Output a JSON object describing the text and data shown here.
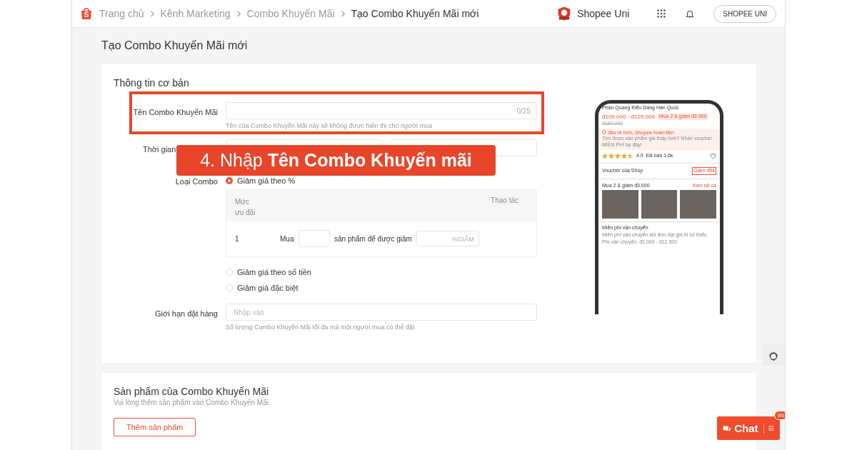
{
  "logo_letter": "S",
  "breadcrumb": [
    {
      "label": "Trang chủ",
      "current": false
    },
    {
      "label": "Kênh Marketing",
      "current": false
    },
    {
      "label": "Combo Khuyến Mãi",
      "current": false
    },
    {
      "label": "Tạo Combo Khuyến Mãi mới",
      "current": true
    }
  ],
  "header": {
    "brand": "Shopee Uni",
    "account_button": "SHOPEE UNI"
  },
  "page_title": "Tạo Combo Khuyến Mãi mới",
  "basic_info": {
    "title": "Thông tin cơ bản",
    "name_field": {
      "label": "Tên Combo Khuyến Mãi",
      "counter": "0/25",
      "hint": "Tên của Combo Khuyến Mãi này sẽ không được hiển thị cho người mua"
    },
    "time_field": {
      "label": "Thời gian"
    },
    "combo_type": {
      "label": "Loại Combo",
      "options": [
        {
          "label": "Giảm giá theo %",
          "selected": true
        },
        {
          "label": "Giảm giá theo số tiền",
          "selected": false
        },
        {
          "label": "Giảm giá đặc biệt",
          "selected": false
        }
      ]
    },
    "tier_table": {
      "columns": [
        "Mức ưu đãi",
        "Thao tác"
      ],
      "rows": [
        {
          "index": "1",
          "buy_label": "Mua",
          "middle_text": "sản phẩm để được giảm",
          "unit": "%GIẢM"
        }
      ]
    },
    "limit_field": {
      "label": "Giới hạn đặt hàng",
      "placeholder": "Nhập vào",
      "hint": "Số lượng Combo Khuyến Mãi tối đa mà một người mua có thể đặt"
    }
  },
  "callout": "4. Nhập **Tên Combo Khuyến mãi**",
  "phone_preview": {
    "title": "Phản Quang Kiểu Dáng Hàn Quốc",
    "price": "đ109.000 - đ129.000",
    "deal_tag": "Mua 2 & giảm đ3.000",
    "old_price": "đ180.000",
    "refund_title": "Ở đâu rẻ hơn, Shopee hoàn tiền",
    "refund_text": "Tìm được sản phẩm giá thấp hơn? Nhấn voucher MIỄN PHÍ tại đây!",
    "stars": 4.5,
    "rating": "4.9",
    "sold": "Đã bán 1,6k",
    "voucher_label": "Voucher của Shop",
    "voucher_tag": "Giảm đ5k",
    "combo_label": "Mua 2 & giảm đ3.000",
    "see_all": "Xem tất cả",
    "shipping_title": "Miễn phí vận chuyển",
    "shipping_text": "Miễn phí vận chuyển khi đơn đạt giá trị tối thiểu",
    "shipping_fee": "Phí vận chuyển: đ1.000 - đ12.500"
  },
  "products": {
    "title": "Sản phẩm của Combo Khuyến Mãi",
    "hint": "Vui lòng thêm sản phẩm vào Combo Khuyến Mãi.",
    "button": "Thêm sản phẩm"
  },
  "chat": {
    "label": "Chat",
    "badge": "86"
  }
}
